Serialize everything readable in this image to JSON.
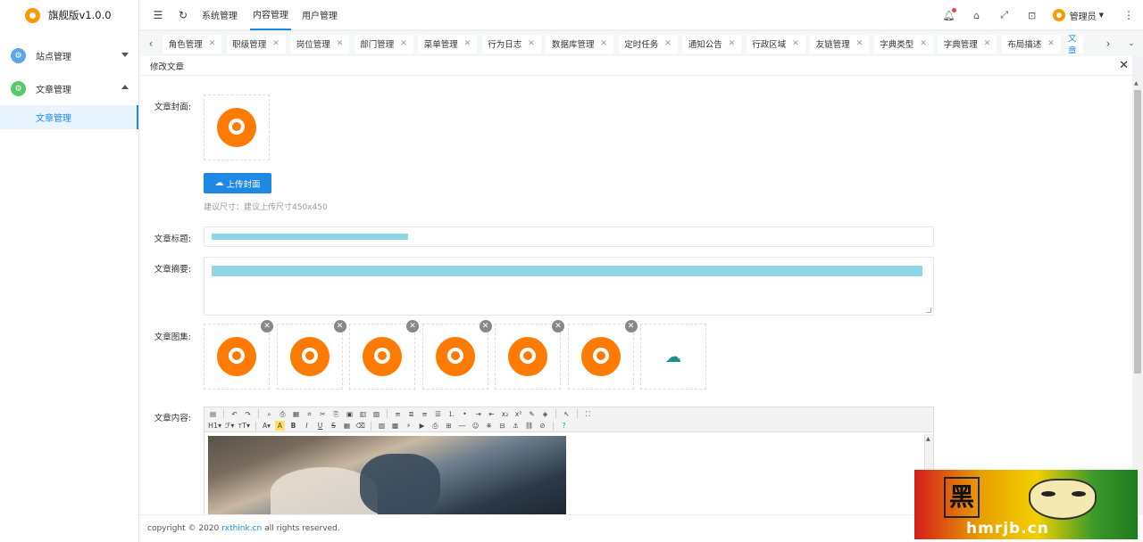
{
  "app": {
    "title": "旗舰版v1.0.0"
  },
  "sidebar": {
    "items": [
      {
        "label": "站点管理",
        "expanded": false
      },
      {
        "label": "文章管理",
        "expanded": true,
        "children": [
          {
            "label": "文章管理",
            "active": true
          }
        ]
      }
    ]
  },
  "topbar": {
    "nav": [
      "系统管理",
      "内容管理",
      "用户管理"
    ],
    "active_nav": "内容管理",
    "user": "管理员"
  },
  "tabs": [
    "角色管理",
    "职级管理",
    "岗位管理",
    "部门管理",
    "菜单管理",
    "行为日志",
    "数据库管理",
    "定时任务",
    "通知公告",
    "行政区域",
    "友链管理",
    "字典类型",
    "字典管理",
    "布局描述",
    "文章"
  ],
  "panel": {
    "title": "修改文章"
  },
  "form": {
    "cover_label": "文章封面:",
    "upload_button": "上传封面",
    "hint": "建议尺寸：建议上传尺寸450x450",
    "title_label": "文章标题:",
    "summary_label": "文章摘要:",
    "gallery_label": "文章图集:",
    "content_label": "文章内容:",
    "gallery_count": 6
  },
  "editor": {
    "heading": "H1",
    "font": "ℱ",
    "fontsize": "ᴛT"
  },
  "footer": {
    "prefix": "copyright © 2020",
    "link": "rxthink.cn",
    "suffix": "all rights reserved."
  },
  "watermark": {
    "site": "hmrjb.cn",
    "seal": "黑"
  },
  "colors": {
    "primary": "#1e88e5",
    "logo": "#ff7a00",
    "notify": "#f44336"
  }
}
